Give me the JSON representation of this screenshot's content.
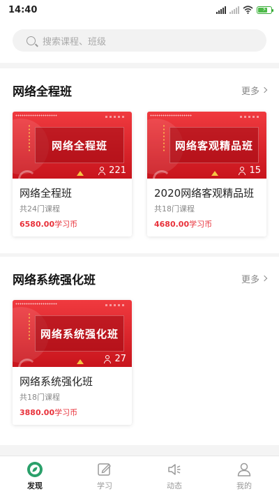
{
  "status_bar": {
    "time": "14:40"
  },
  "search": {
    "placeholder": "搜索课程、班级"
  },
  "sections": [
    {
      "title": "网络全程班",
      "more": "更多",
      "cards": [
        {
          "thumb_text": "网络全程班",
          "count": "221",
          "title": "网络全程班",
          "subtitle": "共24门课程",
          "price": "6580.00",
          "price_unit": "学习币"
        },
        {
          "thumb_text": "网络客观精品班",
          "count": "15",
          "title": "2020网络客观精品班",
          "subtitle": "共18门课程",
          "price": "4680.00",
          "price_unit": "学习币"
        }
      ]
    },
    {
      "title": "网络系统强化班",
      "more": "更多",
      "cards": [
        {
          "thumb_text": "网络系统强化班",
          "count": "27",
          "title": "网络系统强化班",
          "subtitle": "共18门课程",
          "price": "3880.00",
          "price_unit": "学习币"
        }
      ]
    }
  ],
  "tabs": [
    {
      "label": "发现",
      "icon": "discover-icon",
      "active": true
    },
    {
      "label": "学习",
      "icon": "study-icon",
      "active": false
    },
    {
      "label": "动态",
      "icon": "news-icon",
      "active": false
    },
    {
      "label": "我的",
      "icon": "profile-icon",
      "active": false
    }
  ],
  "colors": {
    "accent": "#e8313a",
    "active_tab": "#2aa06a"
  }
}
